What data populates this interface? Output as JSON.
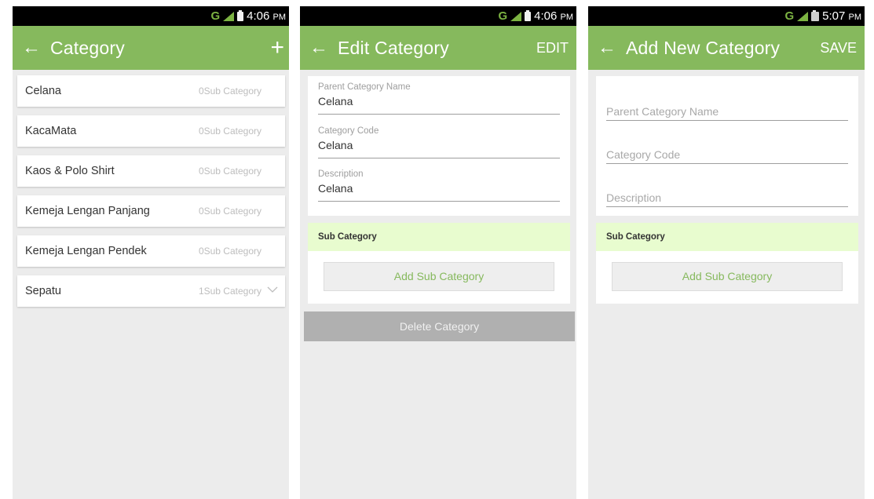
{
  "screen_list": {
    "status": {
      "network": "G",
      "time": "4:06",
      "ampm": "PM"
    },
    "title": "Category",
    "back_icon": "arrow-left-icon",
    "add_icon": "plus-icon",
    "items": [
      {
        "name": "Celana",
        "sub": "0Sub Category"
      },
      {
        "name": "KacaMata",
        "sub": "0Sub Category"
      },
      {
        "name": "Kaos & Polo Shirt",
        "sub": "0Sub Category"
      },
      {
        "name": "Kemeja Lengan Panjang",
        "sub": "0Sub Category"
      },
      {
        "name": "Kemeja Lengan Pendek",
        "sub": "0Sub Category"
      },
      {
        "name": "Sepatu",
        "sub": "1Sub Category"
      }
    ]
  },
  "screen_edit": {
    "status": {
      "network": "G",
      "time": "4:06",
      "ampm": "PM"
    },
    "title": "Edit Category",
    "action": "EDIT",
    "fields": [
      {
        "label": "Parent Category Name",
        "value": "Celana"
      },
      {
        "label": "Category Code",
        "value": "Celana"
      },
      {
        "label": "Description",
        "value": "Celana"
      }
    ],
    "sub_header": "Sub Category",
    "add_sub": "Add Sub Category",
    "delete": "Delete Category"
  },
  "screen_add": {
    "status": {
      "network": "G",
      "time": "5:07",
      "ampm": "PM"
    },
    "title": "Add New Category",
    "action": "SAVE",
    "fields": [
      {
        "placeholder": "Parent Category Name"
      },
      {
        "placeholder": "Category Code"
      },
      {
        "placeholder": "Description"
      }
    ],
    "sub_header": "Sub Category",
    "add_sub": "Add Sub Category"
  },
  "colors": {
    "app_bar": "#86b95d",
    "sub_header_bg": "#e8fccf",
    "accent_text": "#86b95d",
    "delete_bg": "#b0b0b0",
    "screen_bg": "#ececec"
  }
}
